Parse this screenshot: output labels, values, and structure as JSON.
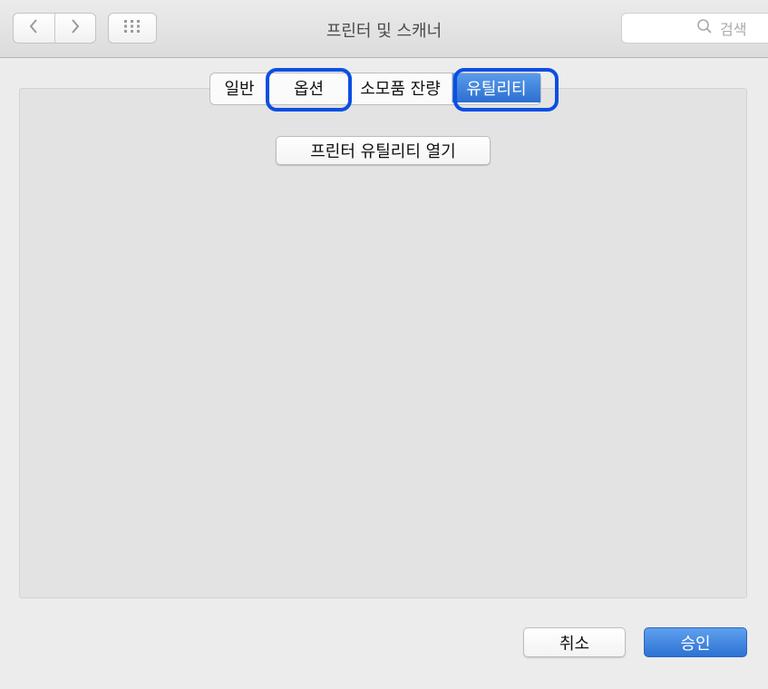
{
  "window": {
    "title": "프린터 및 스캐너"
  },
  "toolbar": {
    "back_icon": "chevron-left-icon",
    "forward_icon": "chevron-right-icon",
    "grid_icon": "grid-icon",
    "search_placeholder": "검색",
    "search_icon": "search-icon"
  },
  "tabs": [
    {
      "label": "일반"
    },
    {
      "label": "옵션"
    },
    {
      "label": "소모품 잔량"
    },
    {
      "label": "유틸리티"
    }
  ],
  "main": {
    "open_utility_label": "프린터 유틸리티 열기"
  },
  "footer": {
    "cancel_label": "취소",
    "ok_label": "승인"
  },
  "colors": {
    "accent": "#2d72d3",
    "highlight": "#0b4fe2"
  }
}
